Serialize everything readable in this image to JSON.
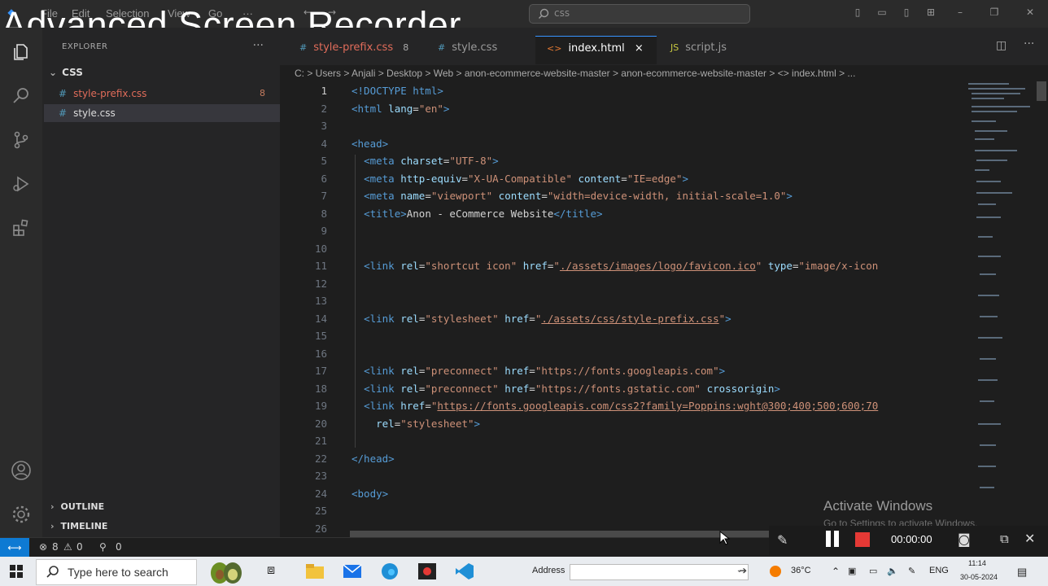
{
  "overlay": {
    "title": "Advanced Screen Recorder"
  },
  "menu": {
    "items": [
      "File",
      "Edit",
      "Selection",
      "View",
      "Go",
      "···"
    ]
  },
  "command_center": {
    "placeholder": "css"
  },
  "sidebar": {
    "header": "EXPLORER",
    "folder": "CSS",
    "files": [
      {
        "name": "style-prefix.css",
        "badge": "8"
      },
      {
        "name": "style.css",
        "badge": ""
      }
    ],
    "sections": [
      "OUTLINE",
      "TIMELINE"
    ]
  },
  "tabs": [
    {
      "icon": "#",
      "label": "style-prefix.css",
      "close": "8"
    },
    {
      "icon": "#",
      "label": "style.css",
      "close": ""
    },
    {
      "icon": "<>",
      "label": "index.html",
      "close": "×"
    },
    {
      "icon": "JS",
      "label": "script.js",
      "close": ""
    }
  ],
  "breadcrumb": "C: > Users > Anjali > Desktop > Web > anon-ecommerce-website-master > anon-ecommerce-website-master > <> index.html > ...",
  "code_lines": [
    {
      "n": "1",
      "html": "<span class='t'>&lt;!DOCTYPE html&gt;</span>"
    },
    {
      "n": "2",
      "html": "<span class='t'>&lt;html</span> <span class='a'>lang</span>=<span class='s'>\"en\"</span><span class='t'>&gt;</span>"
    },
    {
      "n": "3",
      "html": ""
    },
    {
      "n": "4",
      "html": "<span class='t'>&lt;head&gt;</span>"
    },
    {
      "n": "5",
      "html": "  <span class='t'>&lt;meta</span> <span class='a'>charset</span>=<span class='s'>\"UTF-8\"</span><span class='t'>&gt;</span>"
    },
    {
      "n": "6",
      "html": "  <span class='t'>&lt;meta</span> <span class='a'>http-equiv</span>=<span class='s'>\"X-UA-Compatible\"</span> <span class='a'>content</span>=<span class='s'>\"IE=edge\"</span><span class='t'>&gt;</span>"
    },
    {
      "n": "7",
      "html": "  <span class='t'>&lt;meta</span> <span class='a'>name</span>=<span class='s'>\"viewport\"</span> <span class='a'>content</span>=<span class='s'>\"width=device-width, initial-scale=1.0\"</span><span class='t'>&gt;</span>"
    },
    {
      "n": "8",
      "html": "  <span class='t'>&lt;title&gt;</span>Anon - eCommerce Website<span class='t'>&lt;/title&gt;</span>"
    },
    {
      "n": "9",
      "html": ""
    },
    {
      "n": "10",
      "html": ""
    },
    {
      "n": "11",
      "html": "  <span class='t'>&lt;link</span> <span class='a'>rel</span>=<span class='s'>\"shortcut icon\"</span> <span class='a'>href</span>=<span class='s'>\"<span class='u'>./assets/images/logo/favicon.ico</span>\"</span> <span class='a'>type</span>=<span class='s'>\"image/x-icon</span>"
    },
    {
      "n": "12",
      "html": ""
    },
    {
      "n": "13",
      "html": ""
    },
    {
      "n": "14",
      "html": "  <span class='t'>&lt;link</span> <span class='a'>rel</span>=<span class='s'>\"stylesheet\"</span> <span class='a'>href</span>=<span class='s'>\"<span class='u'>./assets/css/style-prefix.css</span>\"</span><span class='t'>&gt;</span>"
    },
    {
      "n": "15",
      "html": ""
    },
    {
      "n": "16",
      "html": ""
    },
    {
      "n": "17",
      "html": "  <span class='t'>&lt;link</span> <span class='a'>rel</span>=<span class='s'>\"preconnect\"</span> <span class='a'>href</span>=<span class='s'>\"https://fonts.googleapis.com\"</span><span class='t'>&gt;</span>"
    },
    {
      "n": "18",
      "html": "  <span class='t'>&lt;link</span> <span class='a'>rel</span>=<span class='s'>\"preconnect\"</span> <span class='a'>href</span>=<span class='s'>\"https://fonts.gstatic.com\"</span> <span class='a'>crossorigin</span><span class='t'>&gt;</span>"
    },
    {
      "n": "19",
      "html": "  <span class='t'>&lt;link</span> <span class='a'>href</span>=<span class='s'>\"<span class='u'>https://fonts.googleapis.com/css2?family=Poppins:wght@300;400;500;600;70</span></span>"
    },
    {
      "n": "20",
      "html": "    <span class='a'>rel</span>=<span class='s'>\"stylesheet\"</span><span class='t'>&gt;</span>"
    },
    {
      "n": "21",
      "html": ""
    },
    {
      "n": "22",
      "html": "<span class='t'>&lt;/head&gt;</span>"
    },
    {
      "n": "23",
      "html": ""
    },
    {
      "n": "24",
      "html": "<span class='t'>&lt;body&gt;</span>"
    },
    {
      "n": "25",
      "html": ""
    },
    {
      "n": "26",
      "html": ""
    }
  ],
  "status": {
    "errors": "8",
    "warnings": "0",
    "ports": "0"
  },
  "watermark": {
    "line1": "Activate Windows",
    "line2": "Go to Settings to activate Windows."
  },
  "recorder": {
    "timer": "00:00:00"
  },
  "taskbar": {
    "search_placeholder": "Type here to search",
    "address_label": "Address",
    "temperature": "36°C",
    "language": "ENG",
    "time": "11:14",
    "date": "30-05-2024"
  },
  "colors": {
    "accent": "#0e7ad3",
    "tab_border": "#3794ff",
    "record": "#e53935"
  }
}
